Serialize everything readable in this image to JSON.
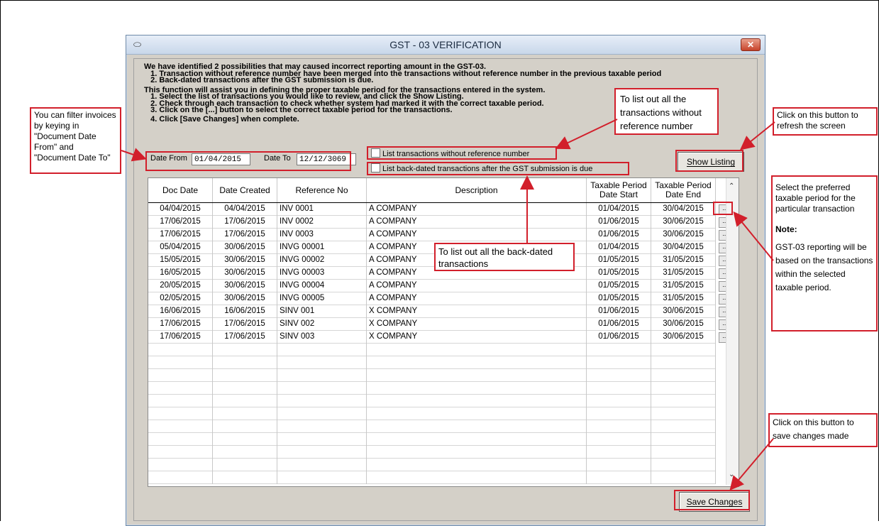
{
  "window": {
    "title": "GST - 03 VERIFICATION",
    "close_glyph": "✕"
  },
  "intro": {
    "line1": "We have identified 2 possibilities that may caused incorrect reporting amount in the GST-03.",
    "line2": "   1. Transaction without reference number have been merged into the transactions without reference number in the previous taxable period",
    "line3": "   2. Back-dated transactions after the GST submission is due.",
    "line4": "This function will assist you in defining the proper taxable period for the transactions entered in the system.",
    "line5": "   1. Select the list of transactions you would like to review, and click the Show Listing.",
    "line6": "   2. Check through each transaction to check whether system had marked it with the correct taxable period.",
    "line7": "   3. Click on the [...] button to select the correct taxable period for the transactions.",
    "line8": "   4. Click [Save Changes] when complete."
  },
  "filters": {
    "date_from_label": "Date From",
    "date_from_value": "01/04/2015",
    "date_to_label": "Date To",
    "date_to_value": "12/12/3069",
    "chk_no_ref": "List transactions without reference number",
    "chk_backdated": "List back-dated transactions after the GST submission is due"
  },
  "buttons": {
    "show_listing": "Show Listing",
    "save_changes": "Save Changes",
    "ellipsis": "..."
  },
  "grid": {
    "headers": {
      "doc_date": "Doc Date",
      "date_created": "Date Created",
      "reference_no": "Reference No",
      "description": "Description",
      "period_start_1": "Taxable Period",
      "period_start_2": "Date Start",
      "period_end_1": "Taxable Period",
      "period_end_2": "Date End"
    },
    "rows": [
      [
        "04/04/2015",
        "04/04/2015",
        "INV 0001",
        "A COMPANY",
        "01/04/2015",
        "30/04/2015"
      ],
      [
        "17/06/2015",
        "17/06/2015",
        "INV 0002",
        "A COMPANY",
        "01/06/2015",
        "30/06/2015"
      ],
      [
        "17/06/2015",
        "17/06/2015",
        "INV 0003",
        "A COMPANY",
        "01/06/2015",
        "30/06/2015"
      ],
      [
        "05/04/2015",
        "30/06/2015",
        "INVG 00001",
        "A COMPANY",
        "01/04/2015",
        "30/04/2015"
      ],
      [
        "15/05/2015",
        "30/06/2015",
        "INVG 00002",
        "A COMPANY",
        "01/05/2015",
        "31/05/2015"
      ],
      [
        "16/05/2015",
        "30/06/2015",
        "INVG 00003",
        "A COMPANY",
        "01/05/2015",
        "31/05/2015"
      ],
      [
        "20/05/2015",
        "30/06/2015",
        "INVG 00004",
        "A COMPANY",
        "01/05/2015",
        "31/05/2015"
      ],
      [
        "02/05/2015",
        "30/06/2015",
        "INVG 00005",
        "A COMPANY",
        "01/05/2015",
        "31/05/2015"
      ],
      [
        "16/06/2015",
        "16/06/2015",
        "SINV 001",
        "X COMPANY",
        "01/06/2015",
        "30/06/2015"
      ],
      [
        "17/06/2015",
        "17/06/2015",
        "SINV 002",
        "X COMPANY",
        "01/06/2015",
        "30/06/2015"
      ],
      [
        "17/06/2015",
        "17/06/2015",
        "SINV 003",
        "X COMPANY",
        "01/06/2015",
        "30/06/2015"
      ]
    ],
    "empty_rows": 11
  },
  "callouts": {
    "filter": "You can filter invoices by keying in \"Document Date From\" and \"Document Date To\"",
    "no_ref": "To list out all the transactions without reference number",
    "refresh": "Click on this button to refresh the screen",
    "backdated": "To list out all the back-dated transactions",
    "period_title": "Select the preferred taxable period for the particular transaction",
    "period_note_label": "Note:",
    "period_note": "GST-03 reporting will be based on the transactions within the selected taxable period.",
    "save": "Click on this button to save changes made"
  },
  "colors": {
    "annotation_red": "#d21f2b",
    "dialog_bg": "#d4d0c8"
  }
}
